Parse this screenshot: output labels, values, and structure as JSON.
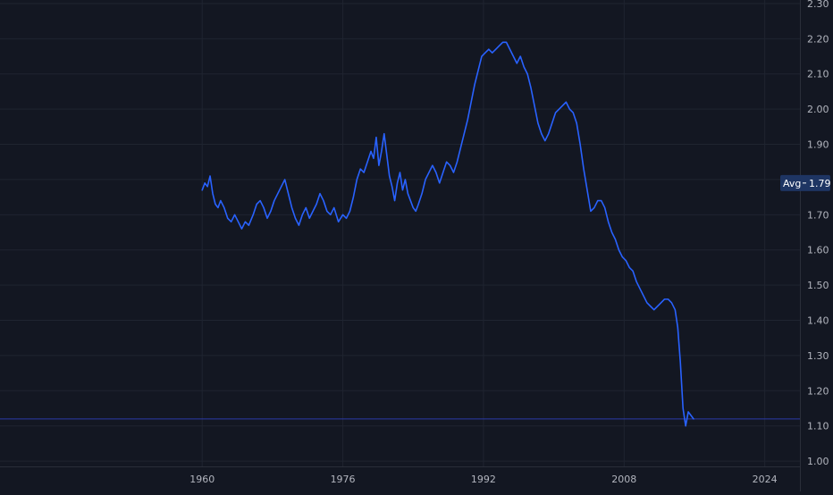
{
  "chart_data": {
    "type": "line",
    "title": "",
    "xlabel": "",
    "ylabel": "",
    "xlim": [
      1937,
      2028
    ],
    "ylim": [
      0.985,
      2.31
    ],
    "y_ticks": [
      1.0,
      1.1,
      1.2,
      1.3,
      1.4,
      1.5,
      1.6,
      1.7,
      1.8,
      1.9,
      2.0,
      2.1,
      2.2,
      2.3
    ],
    "y_tick_labels": [
      "1.00",
      "1.10",
      "1.20",
      "1.30",
      "1.40",
      "1.50",
      "1.60",
      "1.70",
      "1.80",
      "1.90",
      "2.00",
      "2.10",
      "2.20",
      "2.30"
    ],
    "x_ticks": [
      1960,
      1976,
      1992,
      2008,
      2024
    ],
    "x_tick_labels": [
      "1960",
      "1976",
      "1992",
      "2008",
      "2024"
    ],
    "grid": true,
    "avg_value": 1.79,
    "avg_label": "Avg",
    "avg_value_label": "1.79",
    "last_value": 1.12,
    "colors": {
      "background": "#131722",
      "grid": "#1f2430",
      "line": "#2962ff",
      "tick_text": "#b2b5be",
      "avg_badge_bg": "#1e3563",
      "avg_badge_text": "#ffffff",
      "last_value_line": "#2c3ba8"
    },
    "series": [
      {
        "values": [
          [
            1960.0,
            1.77
          ],
          [
            1960.3,
            1.79
          ],
          [
            1960.6,
            1.78
          ],
          [
            1960.9,
            1.81
          ],
          [
            1961.2,
            1.76
          ],
          [
            1961.5,
            1.73
          ],
          [
            1961.8,
            1.72
          ],
          [
            1962.1,
            1.74
          ],
          [
            1962.5,
            1.72
          ],
          [
            1962.9,
            1.69
          ],
          [
            1963.3,
            1.68
          ],
          [
            1963.7,
            1.7
          ],
          [
            1964.1,
            1.68
          ],
          [
            1964.5,
            1.66
          ],
          [
            1964.9,
            1.68
          ],
          [
            1965.3,
            1.67
          ],
          [
            1965.8,
            1.7
          ],
          [
            1966.2,
            1.73
          ],
          [
            1966.6,
            1.74
          ],
          [
            1967.0,
            1.72
          ],
          [
            1967.4,
            1.69
          ],
          [
            1967.8,
            1.71
          ],
          [
            1968.2,
            1.74
          ],
          [
            1968.6,
            1.76
          ],
          [
            1969.0,
            1.78
          ],
          [
            1969.4,
            1.8
          ],
          [
            1969.8,
            1.76
          ],
          [
            1970.2,
            1.72
          ],
          [
            1970.6,
            1.69
          ],
          [
            1971.0,
            1.67
          ],
          [
            1971.4,
            1.7
          ],
          [
            1971.8,
            1.72
          ],
          [
            1972.2,
            1.69
          ],
          [
            1972.6,
            1.71
          ],
          [
            1973.0,
            1.73
          ],
          [
            1973.4,
            1.76
          ],
          [
            1973.8,
            1.74
          ],
          [
            1974.2,
            1.71
          ],
          [
            1974.6,
            1.7
          ],
          [
            1975.0,
            1.72
          ],
          [
            1975.5,
            1.68
          ],
          [
            1976.0,
            1.7
          ],
          [
            1976.4,
            1.69
          ],
          [
            1976.8,
            1.71
          ],
          [
            1977.2,
            1.75
          ],
          [
            1977.6,
            1.8
          ],
          [
            1978.0,
            1.83
          ],
          [
            1978.4,
            1.82
          ],
          [
            1978.8,
            1.85
          ],
          [
            1979.2,
            1.88
          ],
          [
            1979.5,
            1.86
          ],
          [
            1979.8,
            1.92
          ],
          [
            1980.1,
            1.84
          ],
          [
            1980.4,
            1.88
          ],
          [
            1980.7,
            1.93
          ],
          [
            1981.0,
            1.87
          ],
          [
            1981.3,
            1.81
          ],
          [
            1981.6,
            1.78
          ],
          [
            1981.9,
            1.74
          ],
          [
            1982.2,
            1.79
          ],
          [
            1982.5,
            1.82
          ],
          [
            1982.8,
            1.77
          ],
          [
            1983.1,
            1.8
          ],
          [
            1983.4,
            1.76
          ],
          [
            1983.7,
            1.74
          ],
          [
            1984.0,
            1.72
          ],
          [
            1984.3,
            1.71
          ],
          [
            1984.6,
            1.73
          ],
          [
            1985.0,
            1.76
          ],
          [
            1985.4,
            1.8
          ],
          [
            1985.8,
            1.82
          ],
          [
            1986.2,
            1.84
          ],
          [
            1986.6,
            1.82
          ],
          [
            1987.0,
            1.79
          ],
          [
            1987.4,
            1.82
          ],
          [
            1987.8,
            1.85
          ],
          [
            1988.2,
            1.84
          ],
          [
            1988.6,
            1.82
          ],
          [
            1989.0,
            1.85
          ],
          [
            1989.4,
            1.89
          ],
          [
            1989.8,
            1.93
          ],
          [
            1990.2,
            1.97
          ],
          [
            1990.6,
            2.02
          ],
          [
            1991.0,
            2.07
          ],
          [
            1991.4,
            2.11
          ],
          [
            1991.8,
            2.15
          ],
          [
            1992.2,
            2.16
          ],
          [
            1992.6,
            2.17
          ],
          [
            1993.0,
            2.16
          ],
          [
            1993.4,
            2.17
          ],
          [
            1993.8,
            2.18
          ],
          [
            1994.2,
            2.19
          ],
          [
            1994.6,
            2.19
          ],
          [
            1995.0,
            2.17
          ],
          [
            1995.4,
            2.15
          ],
          [
            1995.8,
            2.13
          ],
          [
            1996.2,
            2.15
          ],
          [
            1996.6,
            2.12
          ],
          [
            1997.0,
            2.1
          ],
          [
            1997.4,
            2.06
          ],
          [
            1997.8,
            2.01
          ],
          [
            1998.2,
            1.96
          ],
          [
            1998.6,
            1.93
          ],
          [
            1999.0,
            1.91
          ],
          [
            1999.4,
            1.93
          ],
          [
            1999.8,
            1.96
          ],
          [
            2000.2,
            1.99
          ],
          [
            2000.6,
            2.0
          ],
          [
            2001.0,
            2.01
          ],
          [
            2001.4,
            2.02
          ],
          [
            2001.8,
            2.0
          ],
          [
            2002.2,
            1.99
          ],
          [
            2002.6,
            1.96
          ],
          [
            2003.0,
            1.9
          ],
          [
            2003.4,
            1.83
          ],
          [
            2003.8,
            1.77
          ],
          [
            2004.2,
            1.71
          ],
          [
            2004.6,
            1.72
          ],
          [
            2005.0,
            1.74
          ],
          [
            2005.4,
            1.74
          ],
          [
            2005.8,
            1.72
          ],
          [
            2006.2,
            1.68
          ],
          [
            2006.6,
            1.65
          ],
          [
            2007.0,
            1.63
          ],
          [
            2007.4,
            1.6
          ],
          [
            2007.8,
            1.58
          ],
          [
            2008.2,
            1.57
          ],
          [
            2008.6,
            1.55
          ],
          [
            2009.0,
            1.54
          ],
          [
            2009.4,
            1.51
          ],
          [
            2009.8,
            1.49
          ],
          [
            2010.2,
            1.47
          ],
          [
            2010.6,
            1.45
          ],
          [
            2011.0,
            1.44
          ],
          [
            2011.4,
            1.43
          ],
          [
            2011.8,
            1.44
          ],
          [
            2012.2,
            1.45
          ],
          [
            2012.6,
            1.46
          ],
          [
            2013.0,
            1.46
          ],
          [
            2013.4,
            1.45
          ],
          [
            2013.8,
            1.43
          ],
          [
            2014.1,
            1.38
          ],
          [
            2014.4,
            1.28
          ],
          [
            2014.7,
            1.15
          ],
          [
            2015.0,
            1.1
          ],
          [
            2015.3,
            1.14
          ],
          [
            2015.6,
            1.13
          ],
          [
            2015.9,
            1.12
          ]
        ]
      }
    ]
  }
}
